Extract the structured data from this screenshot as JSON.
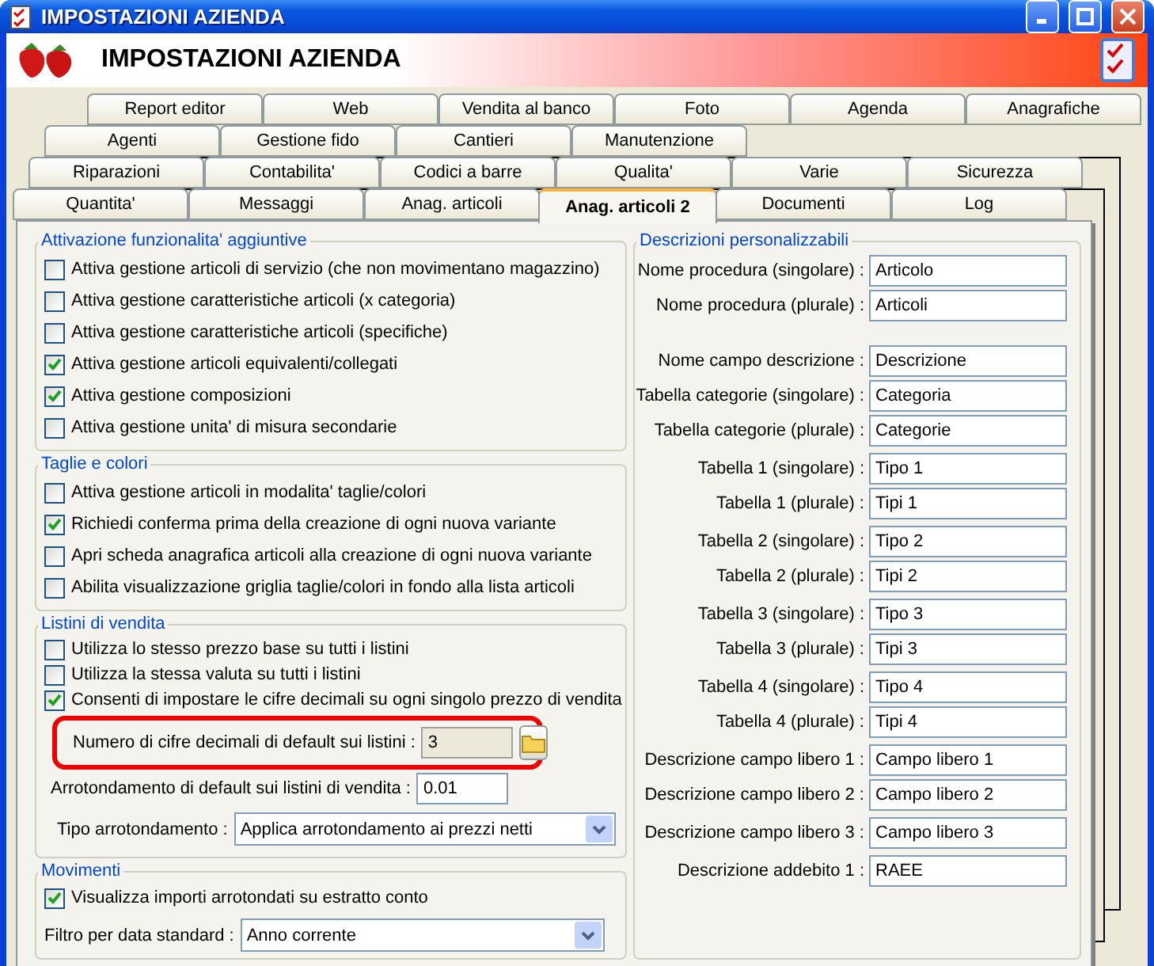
{
  "window": {
    "title": "IMPOSTAZIONI AZIENDA"
  },
  "header": {
    "title": "IMPOSTAZIONI AZIENDA"
  },
  "tab_rows": [
    [
      {
        "label": "Report editor",
        "selected": false
      },
      {
        "label": "Web",
        "selected": false
      },
      {
        "label": "Vendita al banco",
        "selected": false
      },
      {
        "label": "Foto",
        "selected": false
      },
      {
        "label": "Agenda",
        "selected": false
      },
      {
        "label": "Anagrafiche",
        "selected": false
      }
    ],
    [
      {
        "label": "Agenti",
        "selected": false
      },
      {
        "label": "Gestione fido",
        "selected": false
      },
      {
        "label": "Cantieri",
        "selected": false
      },
      {
        "label": "Manutenzione",
        "selected": false
      }
    ],
    [
      {
        "label": "Riparazioni",
        "selected": false
      },
      {
        "label": "Contabilita'",
        "selected": false
      },
      {
        "label": "Codici a barre",
        "selected": false
      },
      {
        "label": "Qualita'",
        "selected": false
      },
      {
        "label": "Varie",
        "selected": false
      },
      {
        "label": "Sicurezza",
        "selected": false
      }
    ],
    [
      {
        "label": "Quantita'",
        "selected": false
      },
      {
        "label": "Messaggi",
        "selected": false
      },
      {
        "label": "Anag. articoli",
        "selected": false
      },
      {
        "label": "Anag. articoli 2",
        "selected": true
      },
      {
        "label": "Documenti",
        "selected": false
      },
      {
        "label": "Log",
        "selected": false
      }
    ]
  ],
  "features": {
    "title": "Attivazione funzionalita' aggiuntive",
    "options": [
      {
        "label": "Attiva gestione articoli di servizio (che non movimentano magazzino)",
        "checked": false
      },
      {
        "label": "Attiva gestione caratteristiche articoli (x categoria)",
        "checked": false
      },
      {
        "label": "Attiva gestione caratteristiche articoli (specifiche)",
        "checked": false
      },
      {
        "label": "Attiva gestione articoli equivalenti/collegati",
        "checked": true
      },
      {
        "label": "Attiva gestione composizioni",
        "checked": true
      },
      {
        "label": "Attiva gestione unita' di misura secondarie",
        "checked": false
      }
    ]
  },
  "sizes_colors": {
    "title": "Taglie e colori",
    "options": [
      {
        "label": "Attiva gestione articoli in modalita' taglie/colori",
        "checked": false
      },
      {
        "label": "Richiedi conferma prima della creazione di ogni nuova variante",
        "checked": true
      },
      {
        "label": "Apri scheda anagrafica articoli alla creazione di ogni nuova variante",
        "checked": false
      },
      {
        "label": "Abilita visualizzazione griglia taglie/colori in fondo alla lista articoli",
        "checked": false
      }
    ]
  },
  "price_lists": {
    "title": "Listini di vendita",
    "options": [
      {
        "label": "Utilizza lo stesso prezzo base su tutti i listini",
        "checked": false
      },
      {
        "label": "Utilizza la stessa valuta su tutti i listini",
        "checked": false
      },
      {
        "label": "Consenti di impostare le cifre decimali su ogni singolo prezzo di vendita",
        "checked": true
      }
    ],
    "decimals": {
      "label": "Numero di cifre decimali di default sui listini :",
      "value": "3",
      "highlighted": true
    },
    "rounding": {
      "label": "Arrotondamento di default sui listini di vendita :",
      "value": "0.01"
    },
    "rounding_type": {
      "label": "Tipo arrotondamento :",
      "value": "Applica arrotondamento ai prezzi netti"
    }
  },
  "movements": {
    "title": "Movimenti",
    "options": [
      {
        "label": "Visualizza importi arrotondati su estratto conto",
        "checked": true
      }
    ],
    "date_filter": {
      "label": "Filtro per data standard :",
      "value": "Anno corrente"
    }
  },
  "descriptions": {
    "title": "Descrizioni personalizzabili",
    "groups": [
      [
        {
          "label": "Nome procedura (singolare) :",
          "value": "Articolo"
        },
        {
          "label": "Nome procedura (plurale) :",
          "value": "Articoli"
        }
      ],
      [
        {
          "label": "Nome campo descrizione :",
          "value": "Descrizione"
        },
        {
          "label": "Tabella categorie (singolare) :",
          "value": "Categoria"
        },
        {
          "label": "Tabella categorie (plurale) :",
          "value": "Categorie"
        }
      ],
      [
        {
          "label": "Tabella 1 (singolare) :",
          "value": "Tipo 1"
        },
        {
          "label": "Tabella 1 (plurale) :",
          "value": "Tipi 1"
        }
      ],
      [
        {
          "label": "Tabella 2 (singolare) :",
          "value": "Tipo 2"
        },
        {
          "label": "Tabella 2 (plurale) :",
          "value": "Tipi 2"
        }
      ],
      [
        {
          "label": "Tabella 3 (singolare) :",
          "value": "Tipo 3"
        },
        {
          "label": "Tabella 3 (plurale) :",
          "value": "Tipi 3"
        }
      ],
      [
        {
          "label": "Tabella 4 (singolare) :",
          "value": "Tipo 4"
        },
        {
          "label": "Tabella 4 (plurale) :",
          "value": "Tipi 4"
        }
      ],
      [
        {
          "label": "Descrizione campo libero 1 :",
          "value": "Campo libero 1"
        },
        {
          "label": "Descrizione campo libero 2 :",
          "value": "Campo libero 2"
        }
      ],
      [
        {
          "label": "Descrizione campo libero 3 :",
          "value": "Campo libero 3"
        }
      ],
      [
        {
          "label": "Descrizione addebito 1 :",
          "value": "RAEE"
        }
      ]
    ]
  }
}
